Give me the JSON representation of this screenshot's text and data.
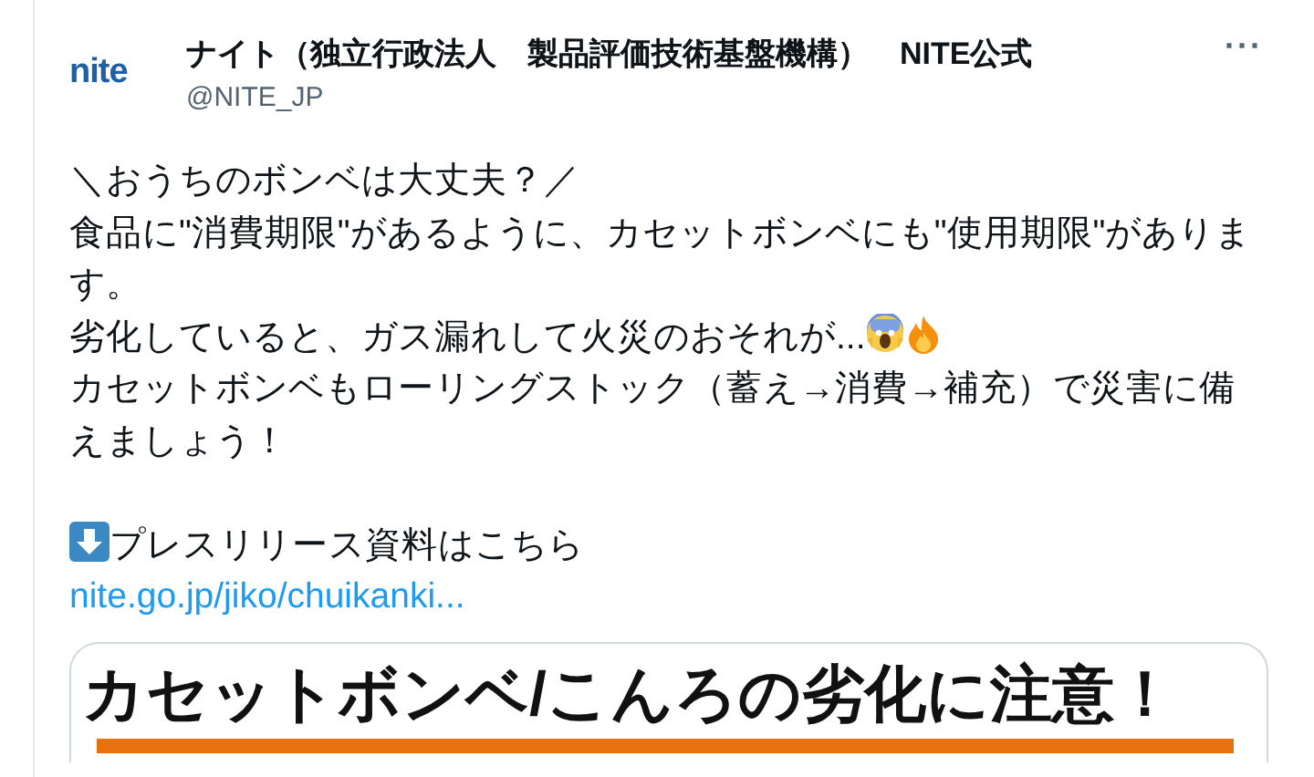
{
  "author": {
    "logo": "nite",
    "name": "ナイト（独立行政法人　製品評価技術基盤機構）　NITE公式",
    "handle": "@NITE_JP",
    "more": "···"
  },
  "body": [
    {
      "kind": "text",
      "text": "＼おうちのボンベは大丈夫？／"
    },
    {
      "kind": "text",
      "text": "食品に\"消費期限\"があるように、カセットボンベにも\"使用期限\"があります。"
    },
    {
      "kind": "emoji",
      "text": "劣化していると、ガス漏れして火災のおそれが..."
    },
    {
      "kind": "text",
      "text": "カセットボンベもローリングストック（蓄え→消費→補充）で災害に備えましょう！"
    },
    {
      "kind": "blank"
    },
    {
      "kind": "arrow",
      "text": "プレスリリース資料はこちら"
    },
    {
      "kind": "link",
      "text": "nite.go.jp/jiko/chuikanki..."
    }
  ],
  "card": {
    "headline": "カセットボンベ/こんろの劣化に注意！"
  }
}
